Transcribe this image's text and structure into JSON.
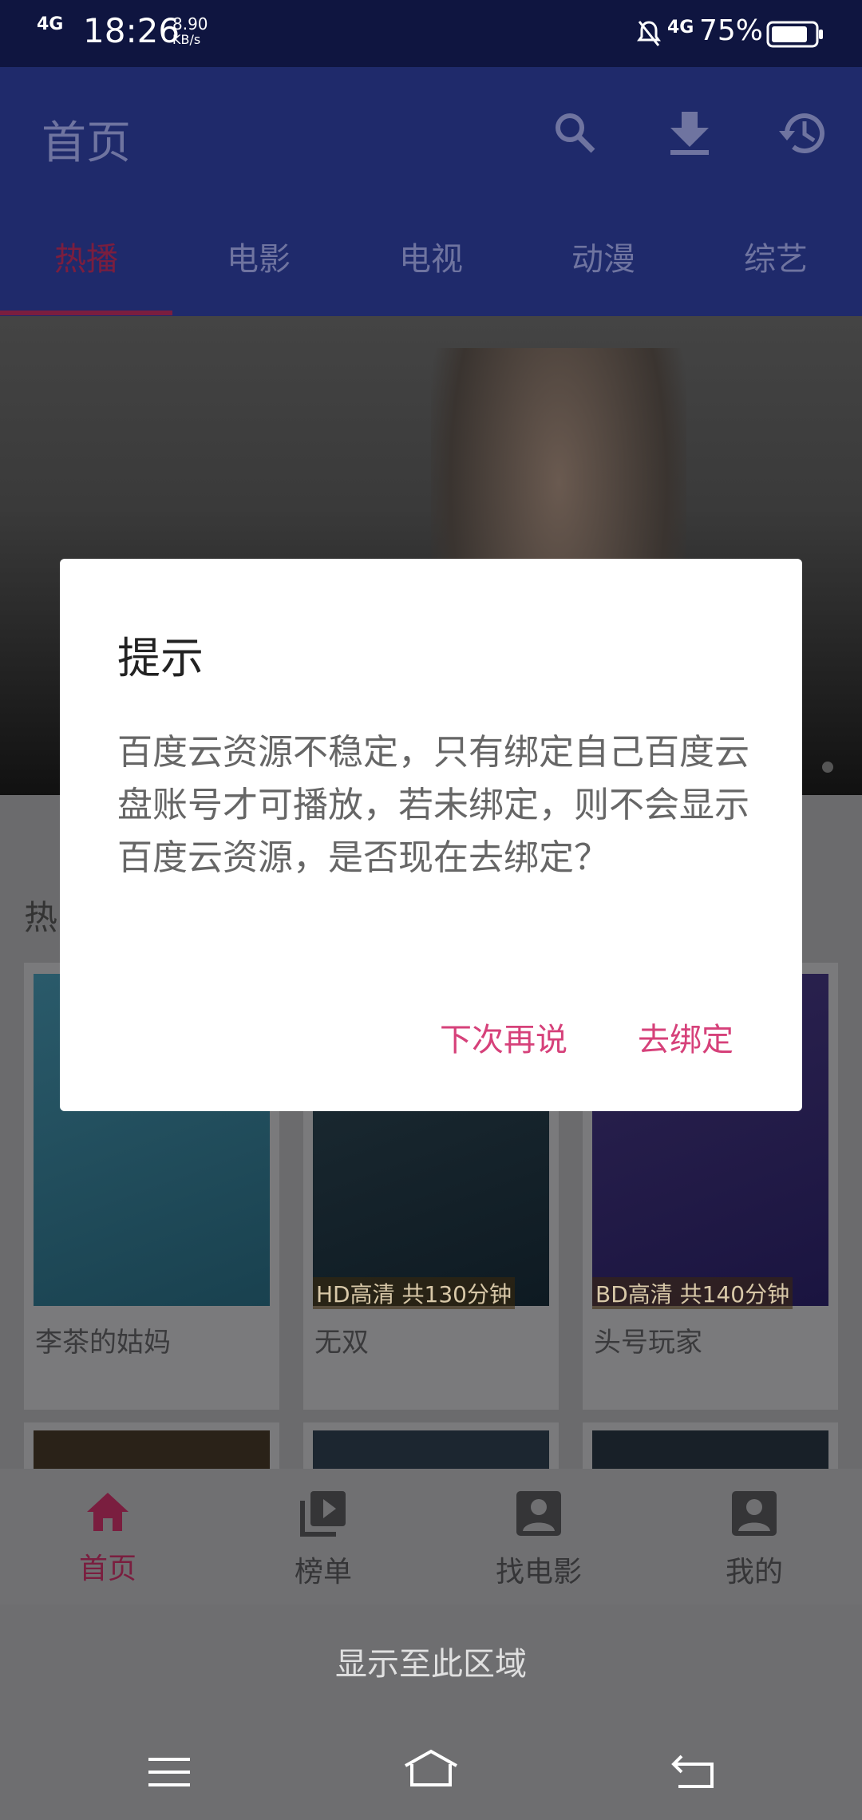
{
  "status_bar": {
    "network": "4G",
    "time": "18:26",
    "speed_value": "8.90",
    "speed_unit": "KB/s",
    "network2": "4G",
    "battery": "75%"
  },
  "app_bar": {
    "title": "首页",
    "icons": [
      "search-icon",
      "download-icon",
      "history-icon"
    ]
  },
  "tabs": [
    {
      "label": "热播",
      "active": true
    },
    {
      "label": "电影",
      "active": false
    },
    {
      "label": "电视",
      "active": false
    },
    {
      "label": "动漫",
      "active": false
    },
    {
      "label": "综艺",
      "active": false
    }
  ],
  "section": {
    "title": "热"
  },
  "cards": [
    {
      "title": "李茶的姑妈",
      "quality": ""
    },
    {
      "title": "无双",
      "quality": "HD高清 共130分钟"
    },
    {
      "title": "头号玩家",
      "quality": "BD高清 共140分钟"
    }
  ],
  "bottom_nav": [
    {
      "label": "首页",
      "icon": "home-icon",
      "active": true
    },
    {
      "label": "榜单",
      "icon": "playlist-icon",
      "active": false
    },
    {
      "label": "找电影",
      "icon": "account-box-icon",
      "active": false
    },
    {
      "label": "我的",
      "icon": "account-box-icon",
      "active": false
    }
  ],
  "hint_area": "显示至此区域",
  "dialog": {
    "title": "提示",
    "message": "百度云资源不稳定，只有绑定自己百度云盘账号才可播放，若未绑定，则不会显示百度云资源，是否现在去绑定？",
    "negative_button": "下次再说",
    "positive_button": "去绑定"
  },
  "colors": {
    "accent": "#d6417a",
    "app_bar": "#1f2a6b",
    "status_bar": "#0f1540"
  }
}
